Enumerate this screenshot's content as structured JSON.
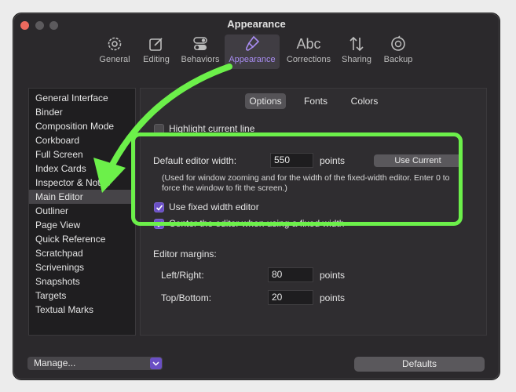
{
  "window": {
    "title": "Appearance"
  },
  "toolbar": {
    "items": [
      {
        "label": "General",
        "icon": "gear-icon"
      },
      {
        "label": "Editing",
        "icon": "pencil-square-icon"
      },
      {
        "label": "Behaviors",
        "icon": "toggle-icon"
      },
      {
        "label": "Appearance",
        "icon": "paintbrush-icon",
        "active": true
      },
      {
        "label": "Corrections",
        "icon": "abc-icon"
      },
      {
        "label": "Sharing",
        "icon": "arrows-updown-icon"
      },
      {
        "label": "Backup",
        "icon": "backup-icon"
      }
    ],
    "abc_glyph": "Abc"
  },
  "sidebar": {
    "items": [
      "General Interface",
      "Binder",
      "Composition Mode",
      "Corkboard",
      "Full Screen",
      "Index Cards",
      "Inspector & Notes",
      "Main Editor",
      "Outliner",
      "Page View",
      "Quick Reference",
      "Scratchpad",
      "Scrivenings",
      "Snapshots",
      "Targets",
      "Textual Marks"
    ],
    "selected": "Main Editor"
  },
  "tabs": {
    "options": "Options",
    "fonts": "Fonts",
    "colors": "Colors",
    "selected": "Options"
  },
  "options": {
    "highlight_line_label": "Highlight current line",
    "highlight_line_checked": false,
    "default_width_label": "Default editor width:",
    "default_width_value": "550",
    "default_width_unit": "points",
    "use_current_label": "Use Current",
    "width_note": "(Used for window zooming and for the width of the fixed-width editor. Enter 0 to force the window to fit the screen.)",
    "fixed_width_label": "Use fixed width editor",
    "fixed_width_checked": true,
    "center_label": "Center the editor when using a fixed width",
    "center_checked": true,
    "margins_label": "Editor margins:",
    "left_right_label": "Left/Right:",
    "left_right_value": "80",
    "left_right_unit": "points",
    "top_bottom_label": "Top/Bottom:",
    "top_bottom_value": "20",
    "top_bottom_unit": "points"
  },
  "bottom": {
    "manage_label": "Manage...",
    "defaults_label": "Defaults"
  },
  "colors": {
    "accent": "#a88cf0",
    "highlight": "#6cf04a",
    "checkbox": "#6a4fc4"
  }
}
